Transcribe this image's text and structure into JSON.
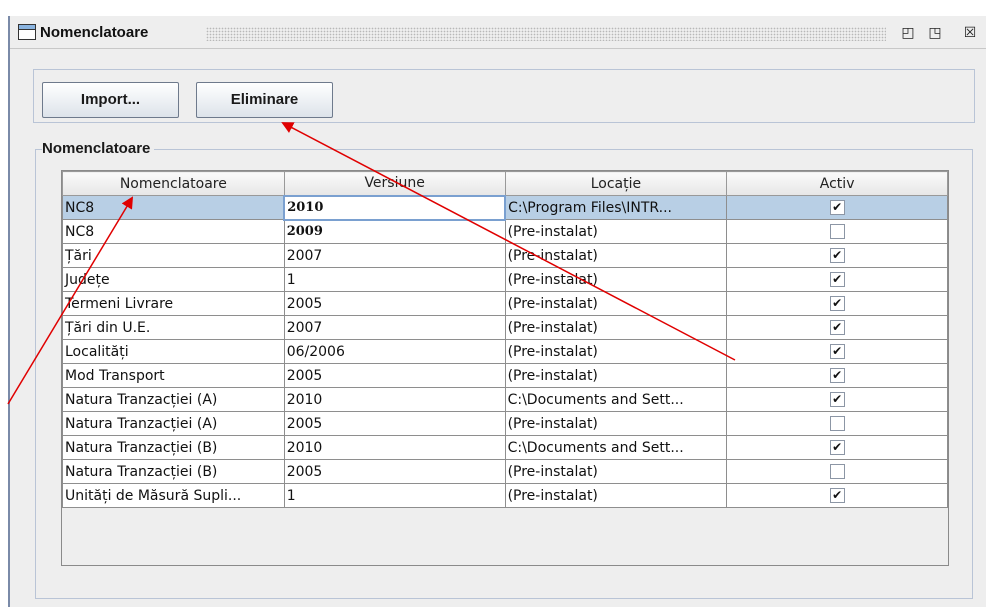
{
  "window": {
    "title": "Nomenclatoare",
    "buttons": {
      "minimize": "◰",
      "maximize": "◳",
      "close": "☒"
    }
  },
  "toolbar": {
    "import_label": "Import...",
    "remove_label": "Eliminare"
  },
  "group": {
    "label": "Nomenclatoare"
  },
  "table": {
    "columns": [
      "Nomenclatoare",
      "Versiune",
      "Locație",
      "Activ"
    ],
    "rows": [
      {
        "name": "NC8",
        "version": "2010",
        "location": "C:\\Program Files\\INTR...",
        "active": true,
        "selected": true,
        "bold_version": true
      },
      {
        "name": "NC8",
        "version": "2009",
        "location": "(Pre-instalat)",
        "active": false,
        "bold_version": true
      },
      {
        "name": "Țări",
        "version": "2007",
        "location": "(Pre-instalat)",
        "active": true
      },
      {
        "name": "Județe",
        "version": "1",
        "location": "(Pre-instalat)",
        "active": true
      },
      {
        "name": "Termeni Livrare",
        "version": "2005",
        "location": "(Pre-instalat)",
        "active": true
      },
      {
        "name": "Țări din U.E.",
        "version": "2007",
        "location": "(Pre-instalat)",
        "active": true
      },
      {
        "name": "Localități",
        "version": "06/2006",
        "location": "(Pre-instalat)",
        "active": true
      },
      {
        "name": "Mod Transport",
        "version": "2005",
        "location": "(Pre-instalat)",
        "active": true
      },
      {
        "name": "Natura Tranzacției (A)",
        "version": "2010",
        "location": "C:\\Documents and Sett...",
        "active": true
      },
      {
        "name": "Natura Tranzacției (A)",
        "version": "2005",
        "location": "(Pre-instalat)",
        "active": false
      },
      {
        "name": "Natura Tranzacției (B)",
        "version": "2010",
        "location": "C:\\Documents and Sett...",
        "active": true
      },
      {
        "name": "Natura Tranzacției (B)",
        "version": "2005",
        "location": "(Pre-instalat)",
        "active": false
      },
      {
        "name": "Unități de Măsură Supli...",
        "version": "1",
        "location": "(Pre-instalat)",
        "active": true
      }
    ]
  },
  "colors": {
    "selection": "#b8cfe5",
    "arrow": "#e00000",
    "frame_border": "#7a8aa8"
  }
}
